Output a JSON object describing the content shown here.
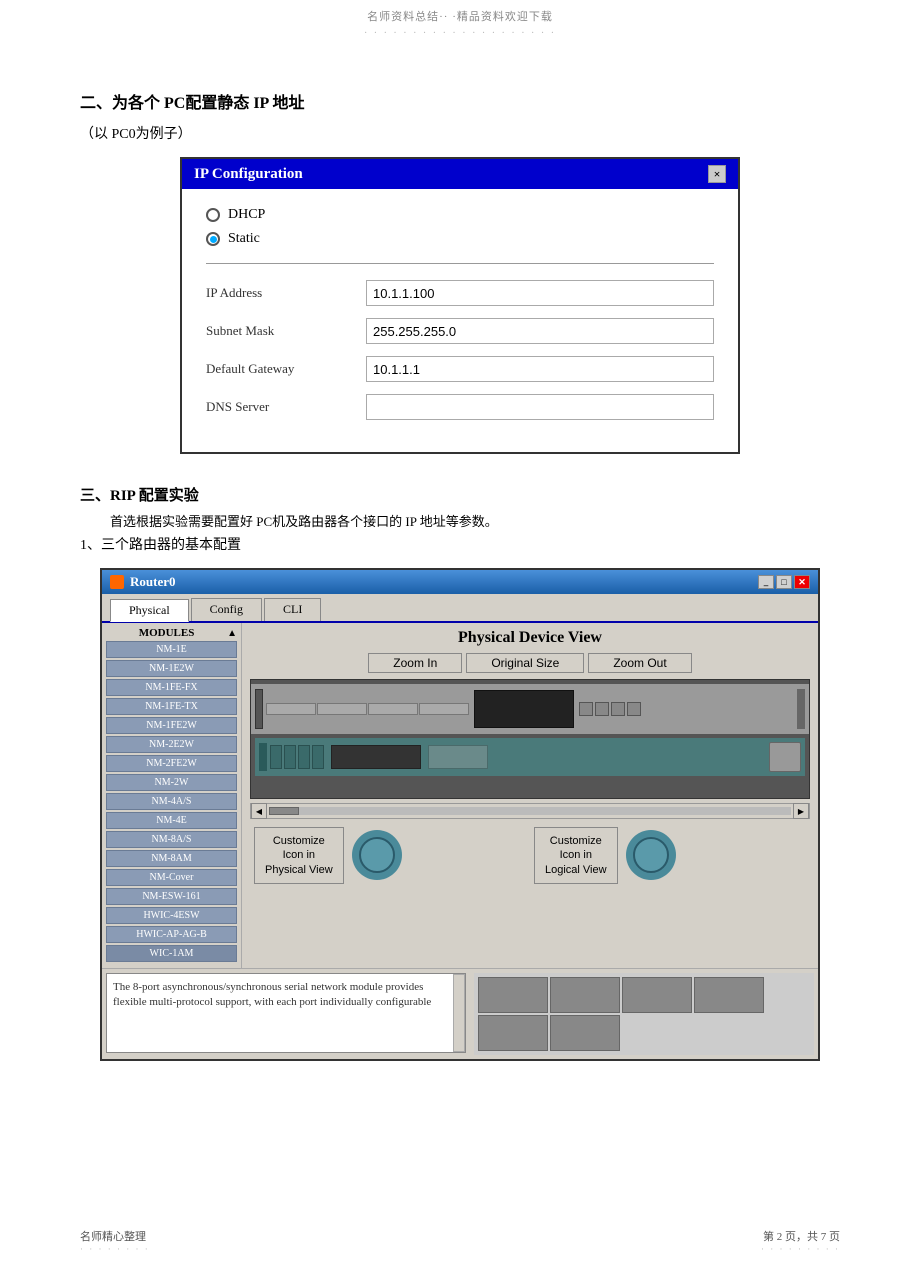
{
  "watermark": {
    "text": "名师资料总结·· ·精品资料欢迎下载",
    "dots": "· · · · · · · · · · · · · · · · · · · ·"
  },
  "section2": {
    "title": "二、为各个  PC配置静态  IP 地址",
    "subtitle": "（以  PC0为例子）"
  },
  "ip_dialog": {
    "title": "IP Configuration",
    "close_label": "×",
    "radio_dhcp": "DHCP",
    "radio_static": "Static",
    "field_ip_label": "IP Address",
    "field_ip_value": "10.1.1.100",
    "field_mask_label": "Subnet Mask",
    "field_mask_value": "255.255.255.0",
    "field_gw_label": "Default Gateway",
    "field_gw_value": "10.1.1.1",
    "field_dns_label": "DNS Server",
    "field_dns_value": ""
  },
  "section3": {
    "title": "三、RIP 配置实验",
    "desc": "首选根据实验需要配置好   PC机及路由器各个接口的   IP 地址等参数。",
    "sub": "1、三个路由器的基本配置"
  },
  "router_window": {
    "title": "Router0",
    "tabs": [
      "Physical",
      "Config",
      "CLI"
    ],
    "active_tab": "Physical",
    "device_view_title": "Physical Device View",
    "zoom_in": "Zoom In",
    "original_size": "Original Size",
    "zoom_out": "Zoom Out",
    "modules_header": "MODULES",
    "modules": [
      "NM-1E",
      "NM-1E2W",
      "NM-1FE-FX",
      "NM-1FE-TX",
      "NM-1FE2W",
      "NM-2E2W",
      "NM-2FE2W",
      "NM-2W",
      "NM-4A/S",
      "NM-4E",
      "NM-8A/S",
      "NM-8AM",
      "NM-Cover",
      "NM-ESW-161",
      "HWIC-4ESW",
      "HWIC-AP-AG-B",
      "WIC-1AM"
    ],
    "customize_physical_label": "Customize\nIcon in\nPhysical View",
    "customize_logical_label": "Customize\nIcon in\nLogical View",
    "description": "The 8-port asynchronous/synchronous serial network module provides flexible multi-protocol support, with each port individually configurable"
  },
  "footer": {
    "left": "名师精心整理",
    "left_dots": "· · · · · · · ·",
    "right": "第 2 页，共 7 页",
    "right_dots": "· · · · · · · · ·"
  }
}
